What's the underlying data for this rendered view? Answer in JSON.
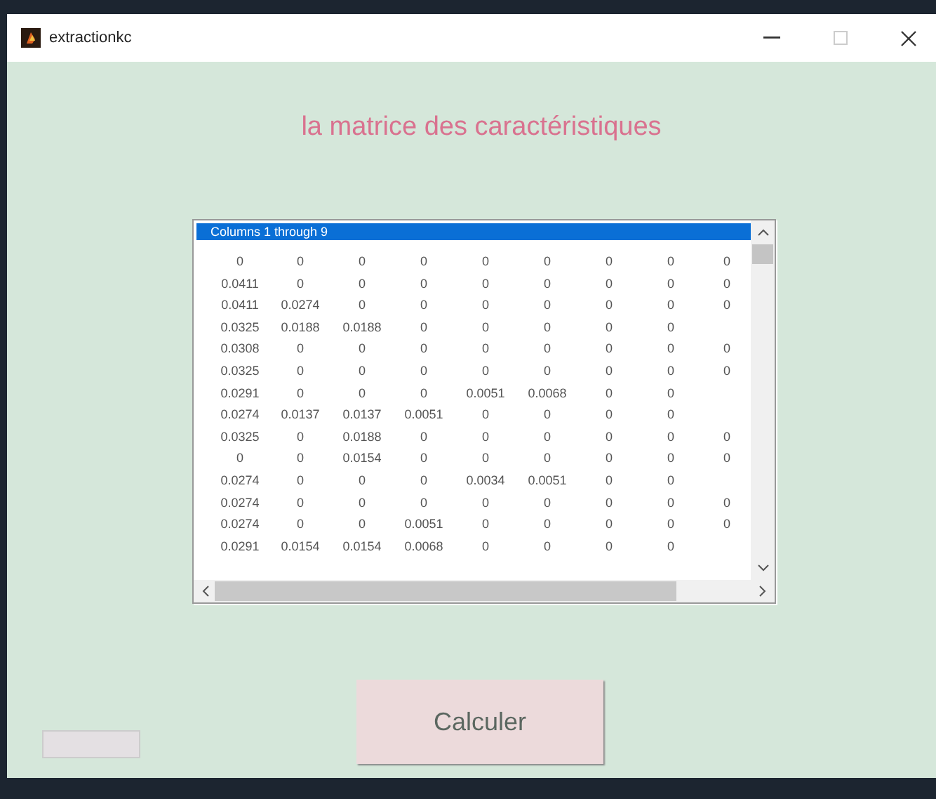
{
  "window": {
    "title": "extractionkc"
  },
  "heading": "la matrice des caractéristiques",
  "listbox": {
    "items": [
      {
        "text": "Columns 1 through 9",
        "selected": true
      }
    ],
    "rows": [
      [
        "0",
        "0",
        "0",
        "0",
        "0",
        "0",
        "0",
        "0",
        "0"
      ],
      [
        "0.0411",
        "0",
        "0",
        "0",
        "0",
        "0",
        "0",
        "0",
        "0"
      ],
      [
        "0.0411",
        "0.0274",
        "0",
        "0",
        "0",
        "0",
        "0",
        "0",
        "0"
      ],
      [
        "0.0325",
        "0.0188",
        "0.0188",
        "0",
        "0",
        "0",
        "0",
        "0"
      ],
      [
        "0.0308",
        "0",
        "0",
        "0",
        "0",
        "0",
        "0",
        "0",
        "0"
      ],
      [
        "0.0325",
        "0",
        "0",
        "0",
        "0",
        "0",
        "0",
        "0",
        "0"
      ],
      [
        "0.0291",
        "0",
        "0",
        "0",
        "0.0051",
        "0.0068",
        "0",
        "0"
      ],
      [
        "0.0274",
        "0.0137",
        "0.0137",
        "0.0051",
        "0",
        "0",
        "0",
        "0"
      ],
      [
        "0.0325",
        "0",
        "0.0188",
        "0",
        "0",
        "0",
        "0",
        "0",
        "0"
      ],
      [
        "0",
        "0",
        "0.0154",
        "0",
        "0",
        "0",
        "0",
        "0",
        "0"
      ],
      [
        "0.0274",
        "0",
        "0",
        "0",
        "0.0034",
        "0.0051",
        "0",
        "0"
      ],
      [
        "0.0274",
        "0",
        "0",
        "0",
        "0",
        "0",
        "0",
        "0",
        "0"
      ],
      [
        "0.0274",
        "0",
        "0",
        "0.0051",
        "0",
        "0",
        "0",
        "0",
        "0"
      ],
      [
        "0.0291",
        "0.0154",
        "0.0154",
        "0.0068",
        "0",
        "0",
        "0",
        "0"
      ]
    ]
  },
  "button": "Calculer"
}
